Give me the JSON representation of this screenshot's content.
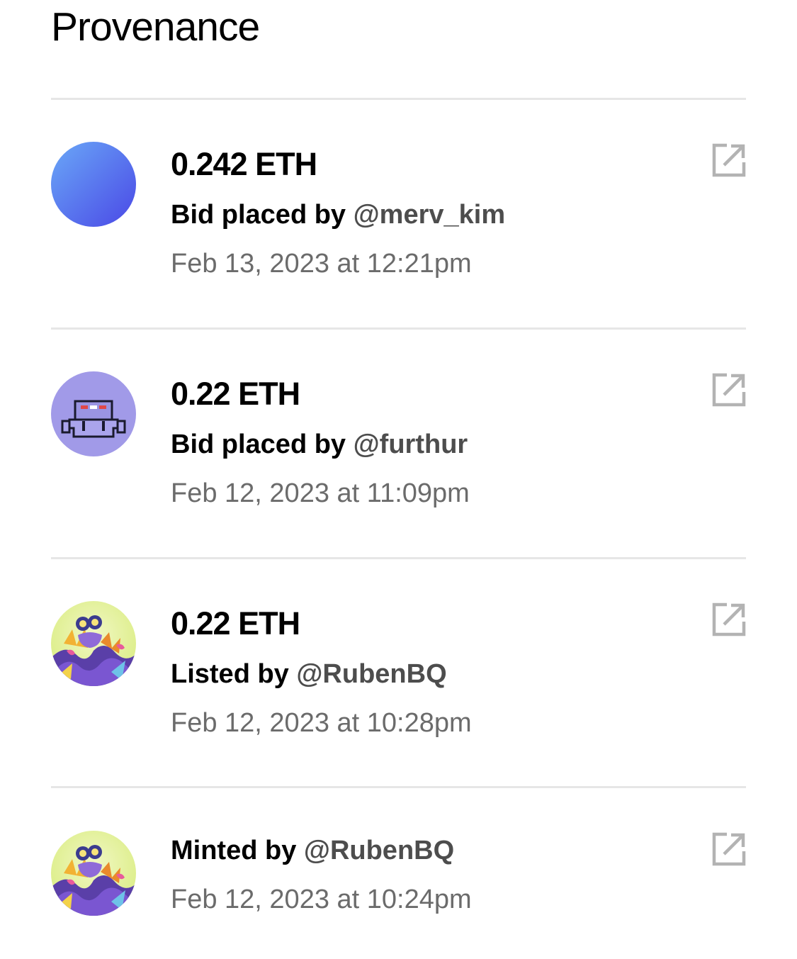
{
  "page_title": "Provenance",
  "colors": {
    "divider": "#e6e6e6",
    "secondary_text": "#6b6b6b",
    "username_text": "#4d4d4d",
    "icon": "#b3b3b3"
  },
  "entries": [
    {
      "amount": "0.242 ETH",
      "action_label": "Bid placed by",
      "username": "@merv_kim",
      "date": "Feb 13, 2023 at 12:21pm",
      "avatar": "blue-gradient-avatar",
      "link_icon": "external-link-icon"
    },
    {
      "amount": "0.22 ETH",
      "action_label": "Bid placed by",
      "username": "@furthur",
      "date": "Feb 12, 2023 at 11:09pm",
      "avatar": "pixel-robot-avatar",
      "link_icon": "external-link-icon"
    },
    {
      "amount": "0.22 ETH",
      "action_label": "Listed by",
      "username": "@RubenBQ",
      "date": "Feb 12, 2023 at 10:28pm",
      "avatar": "colorful-artwork-avatar",
      "link_icon": "external-link-icon"
    },
    {
      "action_label": "Minted by",
      "username": "@RubenBQ",
      "date": "Feb 12, 2023 at 10:24pm",
      "avatar": "colorful-artwork-avatar",
      "link_icon": "external-link-icon"
    }
  ]
}
